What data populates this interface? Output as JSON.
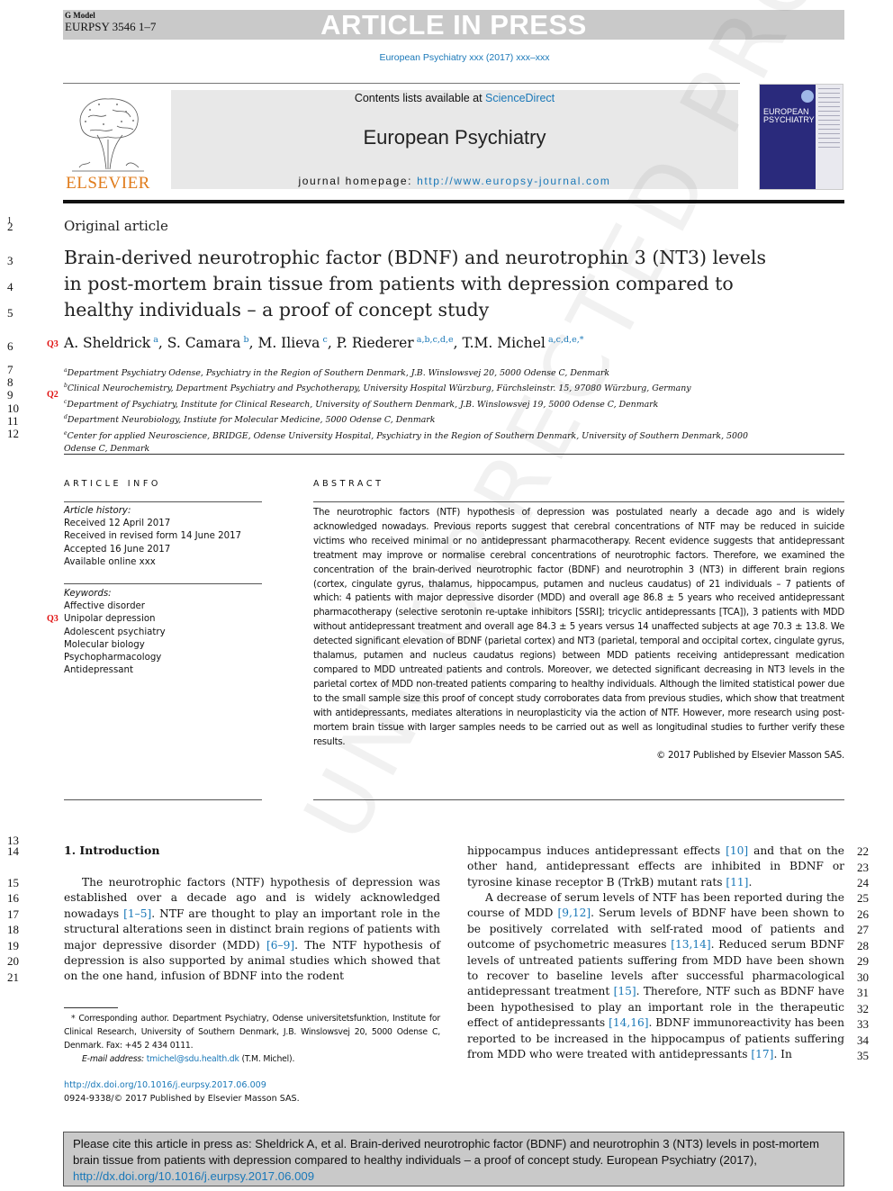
{
  "banner": {
    "g_model": "G Model",
    "manuscript_id": "EURPSY 3546 1–7",
    "status": "ARTICLE IN PRESS"
  },
  "journal_ref": "European Psychiatry xxx (2017) xxx–xxx",
  "masthead": {
    "publisher_logo_text": "ELSEVIER",
    "contents_prefix": "Contents lists available at ",
    "contents_link": "ScienceDirect",
    "journal_title": "European Psychiatry",
    "homepage_prefix": "journal homepage: ",
    "homepage_url": "http://www.europsy-journal.com",
    "cover_title_line1": "EUROPEAN",
    "cover_title_line2": "PSYCHIATRY"
  },
  "line_numbers": {
    "l1": "1",
    "l2": "2",
    "l3": "3",
    "l4": "4",
    "l5": "5",
    "l6": "6",
    "l7": "7",
    "l8": "8",
    "l9": "9",
    "l10": "10",
    "l11": "11",
    "l12": "12",
    "l13": "13",
    "l14": "14",
    "l15": "15",
    "l16": "16",
    "l17": "17",
    "l18": "18",
    "l19": "19",
    "l20": "20",
    "l21": "21",
    "l22": "22",
    "l23": "23",
    "l24": "24",
    "l25": "25",
    "l26": "26",
    "l27": "27",
    "l28": "28",
    "l29": "29",
    "l30": "30",
    "l31": "31",
    "l32": "32",
    "l33": "33",
    "l34": "34",
    "l35": "35"
  },
  "queries": {
    "authors": "Q3",
    "affiliation_c": "Q2",
    "keyword": "Q3"
  },
  "article": {
    "type": "Original article",
    "title": "Brain-derived neurotrophic factor (BDNF) and neurotrophin 3 (NT3) levels in post-mortem brain tissue from patients with depression compared to healthy individuals – a proof of concept study",
    "authors": [
      {
        "name": "A. Sheldrick",
        "sup": "a",
        "sep": ", "
      },
      {
        "name": "S. Camara",
        "sup": "b",
        "sep": ", "
      },
      {
        "name": "M. Ilieva",
        "sup": "c",
        "sep": ", "
      },
      {
        "name": "P. Riederer",
        "sup": "a,b,c,d,e",
        "sep": ", "
      },
      {
        "name": "T.M. Michel",
        "sup": "a,c,d,e,*",
        "sep": ""
      }
    ],
    "affiliations": [
      {
        "key": "a",
        "text": "Department Psychiatry Odense, Psychiatry in the Region of Southern Denmark, J.B. Winslowsvej 20, 5000 Odense C, Denmark"
      },
      {
        "key": "b",
        "text": "Clinical Neurochemistry, Department Psychiatry and Psychotherapy, University Hospital Würzburg, Fürchsleinstr. 15, 97080 Würzburg, Germany"
      },
      {
        "key": "c",
        "text": "Department of Psychiatry, Institute for Clinical Research, University of Southern Denmark, J.B. Winslowsvej 19, 5000 Odense C, Denmark"
      },
      {
        "key": "d",
        "text": "Department Neurobiology, Instiute for Molecular Medicine, 5000 Odense C, Denmark"
      },
      {
        "key": "e",
        "text": "Center for applied Neuroscience, BRIDGE, Odense University Hospital, Psychiatry in the Region of Southern Denmark, University of Southern Denmark, 5000",
        "cont": "Odense C, Denmark"
      }
    ]
  },
  "article_info": {
    "heading": "ARTICLE INFO",
    "history_label": "Article history:",
    "received": "Received 12 April 2017",
    "revised": "Received in revised form 14 June 2017",
    "accepted": "Accepted 16 June 2017",
    "online": "Available online xxx",
    "keywords_label": "Keywords:",
    "keywords": [
      "Affective disorder",
      "Unipolar depression",
      "Adolescent psychiatry",
      "Molecular biology",
      "Psychopharmacology",
      "Antidepressant"
    ]
  },
  "abstract": {
    "heading": "ABSTRACT",
    "text": "The neurotrophic factors (NTF) hypothesis of depression was postulated nearly a decade ago and is widely acknowledged nowadays. Previous reports suggest that cerebral concentrations of NTF may be reduced in suicide victims who received minimal or no antidepressant pharmacotherapy. Recent evidence suggests that antidepressant treatment may improve or normalise cerebral concentrations of neurotrophic factors. Therefore, we examined the concentration of the brain-derived neurotrophic factor (BDNF) and neurotrophin 3 (NT3) in different brain regions (cortex, cingulate gyrus, thalamus, hippocampus, putamen and nucleus caudatus) of 21 individuals – 7 patients of which: 4 patients with major depressive disorder (MDD) and overall age 86.8 ± 5 years who received antidepressant pharmacotherapy (selective serotonin re-uptake inhibitors [SSRI]; tricyclic antidepressants [TCA]), 3 patients with MDD without antidepressant treatment and overall age 84.3 ± 5 years versus 14 unaffected subjects at age 70.3 ± 13.8. We detected significant elevation of BDNF (parietal cortex) and NT3 (parietal, temporal and occipital cortex, cingulate gyrus, thalamus, putamen and nucleus caudatus regions) between MDD patients receiving antidepressant medication compared to MDD untreated patients and controls. Moreover, we detected significant decreasing in NT3 levels in the parietal cortex of MDD non-treated patients comparing to healthy individuals. Although the limited statistical power due to the small sample size this proof of concept study corroborates data from previous studies, which show that treatment with antidepressants, mediates alterations in neuroplasticity via the action of NTF. However, more research using post-mortem brain tissue with larger samples needs to be carried out as well as longitudinal studies to further verify these results.",
    "copyright": "© 2017 Published by Elsevier Masson SAS."
  },
  "watermark": "UNCORRECTED PROOF",
  "introduction": {
    "heading": "1. Introduction",
    "left": [
      {
        "t": "The neurotrophic factors (NTF) hypothesis of depression was established over a decade ago and is widely acknowledged nowadays "
      },
      {
        "ref": "[1–5]"
      },
      {
        "t": ". NTF are thought to play an important role in the structural alterations seen in distinct brain regions of patients with major depressive disorder (MDD) "
      },
      {
        "ref": "[6–9]"
      },
      {
        "t": ". The NTF hypothesis of depression is also supported by animal studies which showed that on the one hand, infusion of BDNF into the rodent"
      }
    ],
    "right_p1": [
      {
        "t": "hippocampus induces antidepressant effects "
      },
      {
        "ref": "[10]"
      },
      {
        "t": " and that on the other hand, antidepressant effects are inhibited in BDNF or tyrosine kinase receptor B (TrkB) mutant rats "
      },
      {
        "ref": "[11]"
      },
      {
        "t": "."
      }
    ],
    "right_p2": [
      {
        "t": "A decrease of serum levels of NTF has been reported during the course of MDD "
      },
      {
        "ref": "[9,12]"
      },
      {
        "t": ". Serum levels of BDNF have been shown to be positively correlated with self-rated mood of patients and outcome of psychometric measures "
      },
      {
        "ref": "[13,14]"
      },
      {
        "t": ". Reduced serum BDNF levels of untreated patients suffering from MDD have been shown to recover to baseline levels after successful pharmacological antidepressant treatment "
      },
      {
        "ref": "[15]"
      },
      {
        "t": ". Therefore, NTF such as BDNF have been hypothesised to play an important role in the therapeutic effect of antidepressants "
      },
      {
        "ref": "[14,16]"
      },
      {
        "t": ". BDNF immunoreactivity has been reported to be increased in the hippocampus of patients suffering from MDD who were treated with antidepressants "
      },
      {
        "ref": "[17]"
      },
      {
        "t": ". In"
      }
    ]
  },
  "footnote": {
    "star": "*",
    "corresponding": " Corresponding author. Department Psychiatry, Odense universitetsfunktion, Institute for Clinical Research, University of Southern Denmark, J.B. Winslowsvej 20, 5000 Odense C, Denmark. Fax: +45 2 434 0111.",
    "email_label": "E-mail address: ",
    "email": "tmichel@sdu.health.dk",
    "email_suffix": " (T.M. Michel).",
    "doi": "http://dx.doi.org/10.1016/j.eurpsy.2017.06.009",
    "issn_line": "0924-9338/© 2017 Published by Elsevier Masson SAS."
  },
  "citation_box": {
    "text": "Please cite this article in press as: Sheldrick A, et al. Brain-derived neurotrophic factor (BDNF) and neurotrophin 3 (NT3) levels in post-mortem brain tissue from patients with depression compared to healthy individuals – a proof of concept study. European Psychiatry (2017), ",
    "doi": "http://dx.doi.org/10.1016/j.eurpsy.2017.06.009"
  }
}
